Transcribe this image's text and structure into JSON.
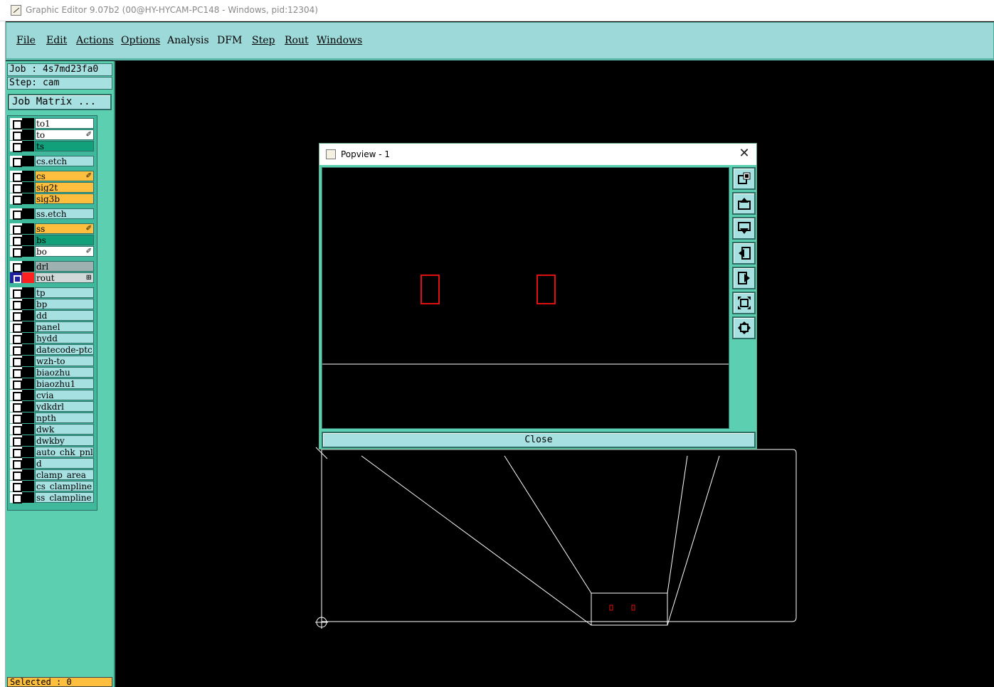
{
  "window": {
    "title": "Graphic Editor 9.07b2 (00@HY-HYCAM-PC148 - Windows, pid:12304)"
  },
  "menu": {
    "items": [
      "File",
      "Edit",
      "Actions",
      "Options",
      "Analysis",
      "DFM",
      "Step",
      "Rout",
      "Windows"
    ]
  },
  "panel": {
    "job": "Job : 4s7md23fa0",
    "step": "Step: cam",
    "job_matrix": "Job Matrix ...",
    "selected": "Selected : 0"
  },
  "layers": [
    {
      "name": "to1",
      "color": "white"
    },
    {
      "name": "to",
      "color": "white",
      "mark": "edit"
    },
    {
      "name": "ts",
      "color": "green"
    },
    {
      "name": "cs.etch",
      "color": "cyan"
    },
    {
      "name": "cs",
      "color": "orange",
      "mark": "edit"
    },
    {
      "name": "sig2t",
      "color": "orange"
    },
    {
      "name": "sig3b",
      "color": "orange"
    },
    {
      "name": "ss.etch",
      "color": "cyan"
    },
    {
      "name": "ss",
      "color": "orange",
      "mark": "edit"
    },
    {
      "name": "bs",
      "color": "green"
    },
    {
      "name": "bo",
      "color": "white",
      "mark": "edit"
    },
    {
      "name": "drl",
      "color": "gray"
    },
    {
      "name": "rout",
      "color": "lgray",
      "mark": "plus",
      "selected": true
    },
    {
      "name": "tp",
      "color": "cyan"
    },
    {
      "name": "bp",
      "color": "cyan"
    },
    {
      "name": "dd",
      "color": "cyan"
    },
    {
      "name": "panel",
      "color": "cyan"
    },
    {
      "name": "hydd",
      "color": "cyan"
    },
    {
      "name": "datecode-ptc",
      "color": "cyan"
    },
    {
      "name": "wzh-to",
      "color": "cyan"
    },
    {
      "name": "biaozhu",
      "color": "cyan"
    },
    {
      "name": "biaozhu1",
      "color": "cyan"
    },
    {
      "name": "cvia",
      "color": "cyan"
    },
    {
      "name": "ydkdrl",
      "color": "cyan"
    },
    {
      "name": "npth",
      "color": "cyan"
    },
    {
      "name": "dwk",
      "color": "cyan"
    },
    {
      "name": "dwkby",
      "color": "cyan"
    },
    {
      "name": "auto_chk_pnl",
      "color": "cyan"
    },
    {
      "name": "d",
      "color": "cyan"
    },
    {
      "name": "clamp_area",
      "color": "cyan"
    },
    {
      "name": "cs_clampline",
      "color": "cyan"
    },
    {
      "name": "ss_clampline",
      "color": "cyan"
    }
  ],
  "popview": {
    "title": "Popview - 1",
    "close_label": "Close",
    "tools": [
      "zoom-window-icon",
      "pan-up-icon",
      "pan-down-icon",
      "pan-left-icon",
      "pan-right-icon",
      "zoom-out-icon",
      "zoom-in-icon"
    ]
  },
  "colors": {
    "panel_bg": "#5bcfb0",
    "button_bg": "#a6e0e0",
    "feature_red": "#e01010",
    "layer_orange": "#ffbe3e",
    "layer_green": "#12a07a"
  }
}
